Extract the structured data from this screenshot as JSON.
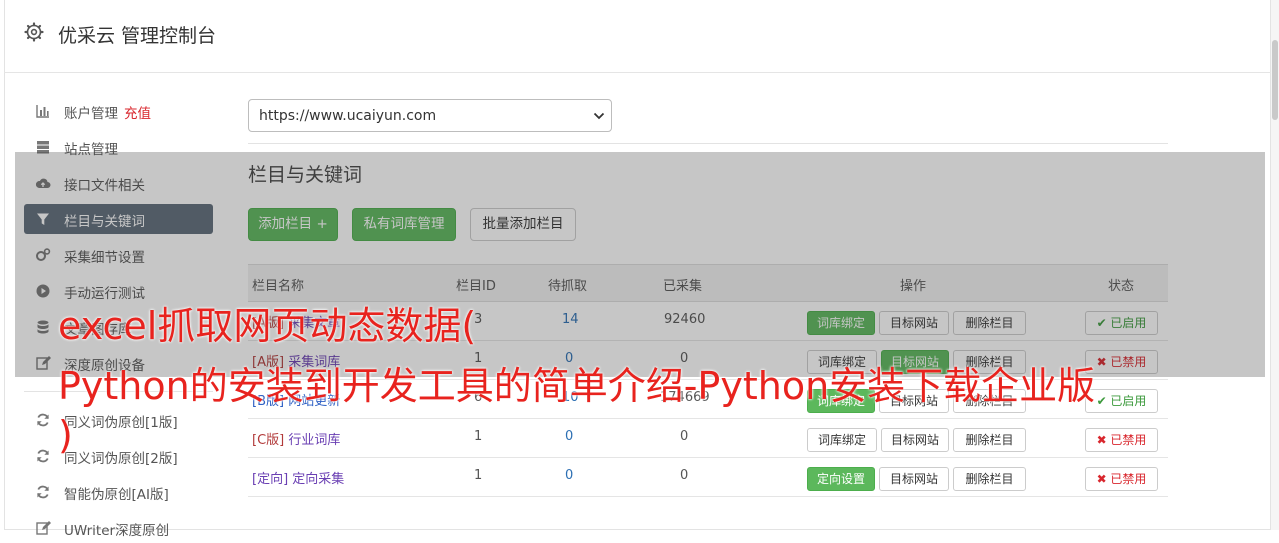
{
  "header": {
    "title": "优采云 管理控制台",
    "icon": "gear-icon"
  },
  "sidebar": {
    "items": [
      {
        "label": "账户管理",
        "extra": "充值",
        "icon": "bar-chart-icon",
        "active": false
      },
      {
        "label": "站点管理",
        "icon": "server-icon",
        "active": false
      },
      {
        "label": "接口文件相关",
        "icon": "cloud-upload-icon",
        "active": false
      },
      {
        "label": "栏目与关键词",
        "icon": "filter-icon",
        "active": true
      },
      {
        "label": "采集细节设置",
        "icon": "cogs-icon",
        "active": false
      },
      {
        "label": "手动运行测试",
        "icon": "play-circle-icon",
        "active": false
      },
      {
        "label": "文章图存库",
        "icon": "database-icon",
        "active": false
      },
      {
        "label": "深度原创设备",
        "icon": "edit-icon",
        "active": false
      }
    ],
    "items2": [
      {
        "label": "同义词伪原创[1版]",
        "icon": "refresh-icon"
      },
      {
        "label": "同义词伪原创[2版]",
        "icon": "refresh-icon"
      },
      {
        "label": "智能伪原创[AI版]",
        "icon": "refresh-icon"
      },
      {
        "label": "UWriter深度原创",
        "icon": "edit-icon"
      }
    ]
  },
  "site_select": {
    "value": "https://www.ucaiyun.com"
  },
  "section": {
    "title": "栏目与关键词",
    "add_column": "添加栏目 +",
    "private_lib": "私有词库管理",
    "batch_add": "批量添加栏目"
  },
  "table": {
    "headers": {
      "name": "栏目名称",
      "id": "栏目ID",
      "pending": "待抓取",
      "collected": "已采集",
      "ops": "操作",
      "status": "状态"
    },
    "ops_labels": {
      "bind": "词库绑定",
      "target": "目标网站",
      "delete": "删除栏目",
      "directed": "定向设置"
    },
    "rows": [
      {
        "tag": "[A版]",
        "name": "采集文章",
        "id": "3",
        "pending": "14",
        "collected": "92460",
        "status": "✔ 已启用",
        "on": true,
        "first_green": true,
        "second_green": false
      },
      {
        "tag": "[A版]",
        "name": "采集词库",
        "id": "1",
        "pending": "0",
        "collected": "0",
        "status": "✖ 已禁用",
        "on": false,
        "first_green": false,
        "second_green": true
      },
      {
        "tag": "[B版]",
        "name": "网站更新",
        "id": "6",
        "pending": "10",
        "collected": "174669",
        "status": "✔ 已启用",
        "on": true,
        "first_green": true,
        "second_green": false
      },
      {
        "tag": "[C版]",
        "name": "行业词库",
        "id": "1",
        "pending": "0",
        "collected": "0",
        "status": "✖ 已禁用",
        "on": false,
        "first_green": false,
        "second_green": false
      },
      {
        "tag": "[定向]",
        "name": "定向采集",
        "id": "1",
        "pending": "0",
        "collected": "0",
        "status": "✖ 已禁用",
        "on": false,
        "first_green": true,
        "second_green": false
      }
    ]
  },
  "ad_overlay": {
    "line1": "excel抓取网页动态数据(",
    "line2": "Python的安装到开发工具的简单介绍-Python安装下载企业版",
    "line3": ")"
  },
  "colors": {
    "accent_green": "#5cb85c",
    "sidebar_active": "#5d6b79",
    "red": "#d9272e",
    "ad_red": "#e8231e"
  }
}
